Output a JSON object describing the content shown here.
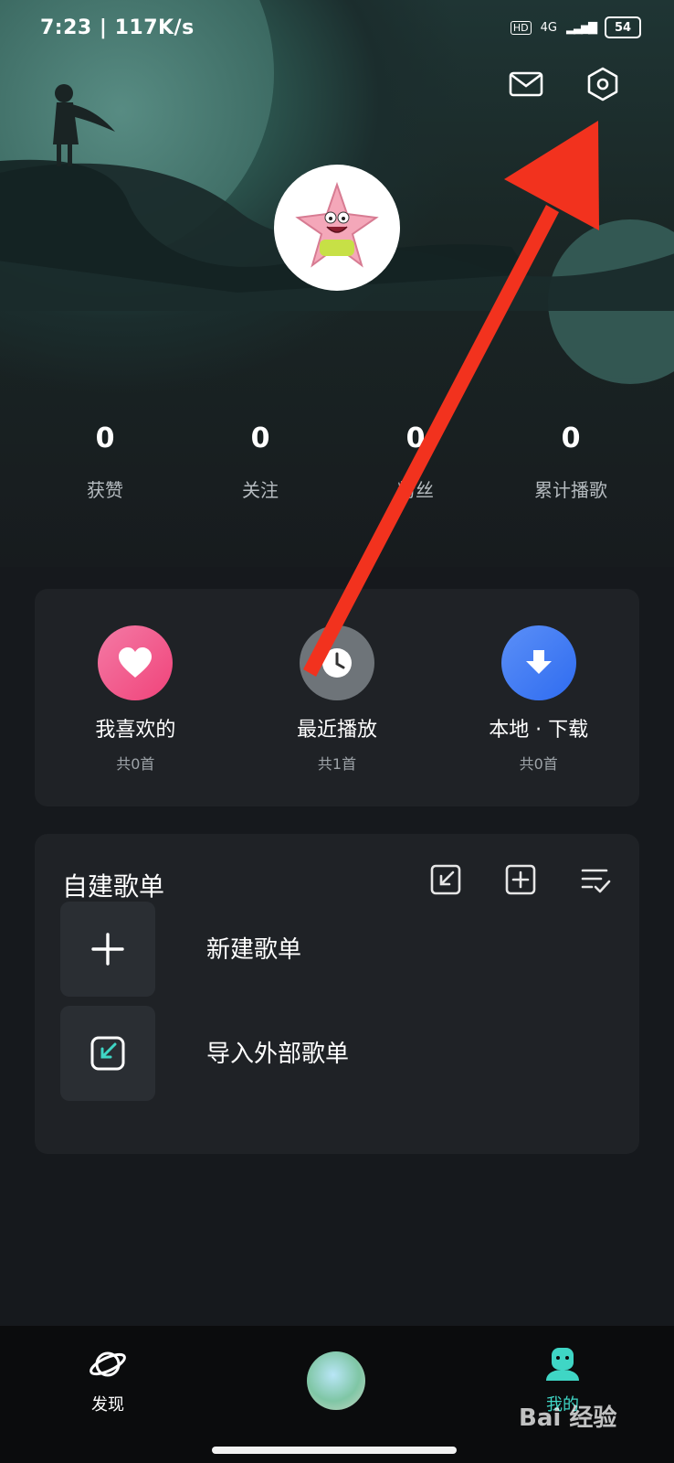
{
  "status": {
    "time": "7:23 | 117K/s",
    "network": "4G",
    "battery": "54"
  },
  "stats": [
    {
      "num": "0",
      "label": "获赞"
    },
    {
      "num": "0",
      "label": "关注"
    },
    {
      "num": "0",
      "label": "粉丝"
    },
    {
      "num": "0",
      "label": "累计播歌"
    }
  ],
  "quick": [
    {
      "label": "我喜欢的",
      "sub": "共0首",
      "icon": "heart-icon",
      "color": "#f2588a"
    },
    {
      "label": "最近播放",
      "sub": "共1首",
      "icon": "clock-icon",
      "color": "#6e7479"
    },
    {
      "label": "本地 · 下载",
      "sub": "共0首",
      "icon": "download-icon",
      "color": "#3d7cf5"
    }
  ],
  "playlist": {
    "title": "自建歌单",
    "new_label": "新建歌单",
    "import_label": "导入外部歌单"
  },
  "tabs": {
    "discover": "发现",
    "mine": "我的"
  },
  "watermark": "Bai 经验",
  "colors": {
    "accent": "#3fd6c5",
    "annotation_arrow": "#f2321e"
  }
}
